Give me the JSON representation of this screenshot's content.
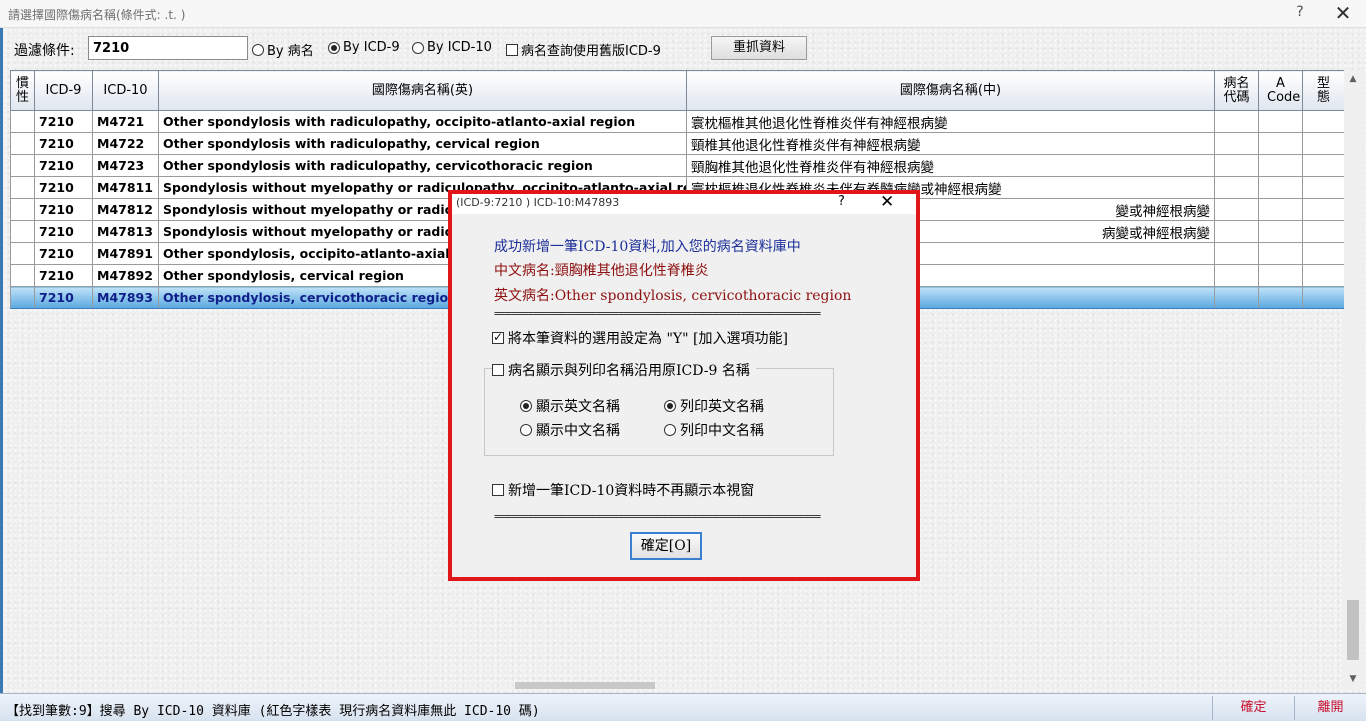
{
  "window": {
    "title": "請選擇國際傷病名稱(條件式: .t. )",
    "help": "?",
    "close": "✕"
  },
  "filter": {
    "label": "過濾條件:",
    "value": "7210",
    "options": [
      "By 病名",
      "By ICD-9",
      "By ICD-10"
    ],
    "selected": "By ICD-9",
    "old_version_check": "病名查詢使用舊版ICD-9",
    "refetch_button": "重抓資料"
  },
  "table": {
    "headers": [
      "慣性",
      "ICD-9",
      "ICD-10",
      "國際傷病名稱(英)",
      "國際傷病名稱(中)",
      "病名代碼",
      "A Code",
      "型態"
    ],
    "rows": [
      {
        "icd9": "7210",
        "icd10": "M4721",
        "en": "Other spondylosis with radiculopathy, occipito-atlanto-axial region",
        "zh": "寰枕樞椎其他退化性脊椎炎伴有神經根病變"
      },
      {
        "icd9": "7210",
        "icd10": "M4722",
        "en": "Other spondylosis with radiculopathy, cervical region",
        "zh": "頸椎其他退化性脊椎炎伴有神經根病變"
      },
      {
        "icd9": "7210",
        "icd10": "M4723",
        "en": "Other spondylosis with radiculopathy, cervicothoracic region",
        "zh": "頸胸椎其他退化性脊椎炎伴有神經根病變"
      },
      {
        "icd9": "7210",
        "icd10": "M47811",
        "en": "Spondylosis without myelopathy or radiculopathy, occipito-atlanto-axial region",
        "zh": "寰枕樞椎退化性脊椎炎未伴有脊髓病變或神經根病變"
      },
      {
        "icd9": "7210",
        "icd10": "M47812",
        "en": "Spondylosis without myelopathy or radiculo",
        "zh": "變或神經根病變"
      },
      {
        "icd9": "7210",
        "icd10": "M47813",
        "en": "Spondylosis without myelopathy or radiculo",
        "zh": "病變或神經根病變"
      },
      {
        "icd9": "7210",
        "icd10": "M47891",
        "en": "Other spondylosis, occipito-atlanto-axial reg",
        "zh": ""
      },
      {
        "icd9": "7210",
        "icd10": "M47892",
        "en": "Other spondylosis, cervical region",
        "zh": ""
      },
      {
        "icd9": "7210",
        "icd10": "M47893",
        "en": "Other spondylosis, cervicothoracic region",
        "zh": ""
      }
    ],
    "selected_index": 8
  },
  "statusbar": {
    "message": "【找到筆數:9】搜尋 By ICD-10 資料庫 (紅色字樣表 現行病名資料庫無此 ICD-10 碼)",
    "ok_button": "確定",
    "leave_button": "離開"
  },
  "dialog": {
    "title": "(ICD-9:7210  ) ICD-10:M47893",
    "help": "?",
    "close": "✕",
    "line_success": "成功新增一筆ICD-10資料,加入您的病名資料庫中",
    "line_zh": "中文病名:頸胸椎其他退化性脊椎炎",
    "line_en": "英文病名:Other spondylosis, cervicothoracic region",
    "separator": "==========================================================",
    "check_set_y": "將本筆資料的選用設定為 \"Y\" [加入選項功能]",
    "check_use_icd9": "病名顯示與列印名稱沿用原ICD-9 名稱",
    "radio_show_en": "顯示英文名稱",
    "radio_print_en": "列印英文名稱",
    "radio_show_zh": "顯示中文名稱",
    "radio_print_zh": "列印中文名稱",
    "check_no_show": "新增一筆ICD-10資料時不再顯示本視窗",
    "confirm_button": "確定[O]"
  }
}
